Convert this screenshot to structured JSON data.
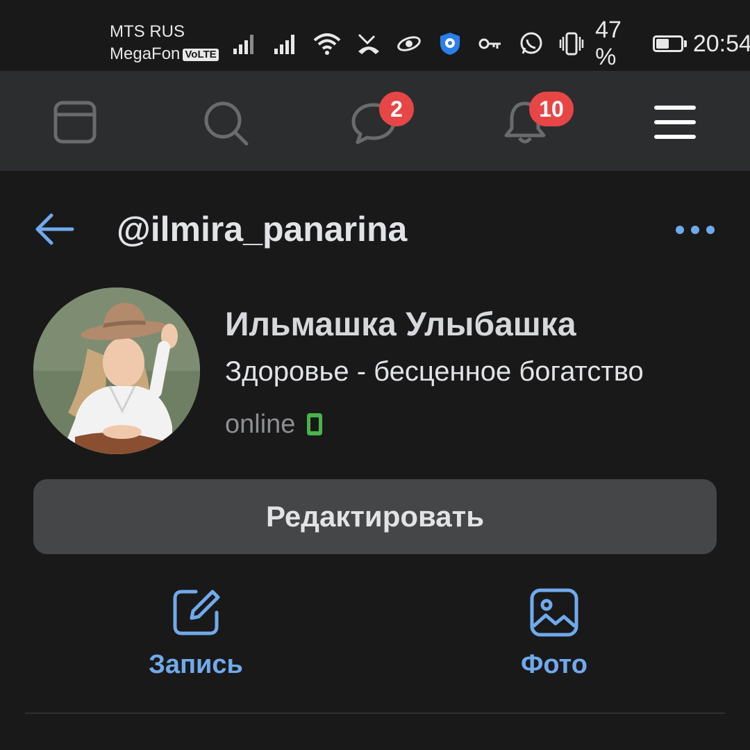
{
  "status_bar": {
    "carrier_1": "MTS RUS",
    "carrier_2": "MegaFon",
    "volte": "VoLTE",
    "icons": [
      "signal-icon",
      "signal-icon",
      "wifi-icon",
      "missed-call-icon",
      "app-icon",
      "shield-icon",
      "key-icon",
      "whatsapp-icon",
      "vibrate-icon"
    ],
    "battery_percent": "47 %",
    "battery_level": 0.47,
    "time": "20:54"
  },
  "top_nav": {
    "items": [
      {
        "icon": "feed-icon"
      },
      {
        "icon": "search-icon"
      },
      {
        "icon": "messages-icon",
        "badge": "2"
      },
      {
        "icon": "notifications-icon",
        "badge": "10"
      },
      {
        "icon": "menu-icon"
      }
    ]
  },
  "header": {
    "username": "@ilmira_panarina"
  },
  "profile": {
    "full_name": "Ильмашка Улыбашка",
    "status": "Здоровье - бесценное богатство",
    "online": "online"
  },
  "edit_button": "Редактировать",
  "actions": {
    "post_label": "Запись",
    "photo_label": "Фото"
  },
  "colors": {
    "accent": "#71aaeb",
    "badge": "#e64646",
    "online_mobile": "#4bb34b",
    "background": "#19191a",
    "nav_background": "#2c2d2f"
  }
}
